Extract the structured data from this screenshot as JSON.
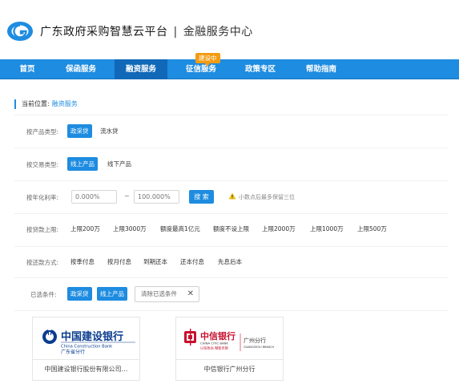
{
  "header": {
    "site_title": "广东政府采购智慧云平台",
    "separator": "|",
    "subtitle": "金融服务中心"
  },
  "nav": {
    "items": [
      {
        "label": "首页",
        "active": false
      },
      {
        "label": "保函服务",
        "active": false
      },
      {
        "label": "融资服务",
        "active": true
      },
      {
        "label": "征信服务",
        "active": false
      },
      {
        "label": "政策专区",
        "active": false
      },
      {
        "label": "帮助指南",
        "active": false
      }
    ],
    "badge": "建设中"
  },
  "breadcrumb": {
    "label": "当前位置:",
    "current": "融资服务"
  },
  "filters": {
    "product_type": {
      "label": "按产品类型:",
      "options": [
        "政采贷",
        "流水贷"
      ],
      "selected": "政采贷"
    },
    "trade_type": {
      "label": "按交易类型:",
      "options": [
        "线上产品",
        "线下产品"
      ],
      "selected": "线上产品"
    },
    "annual_rate": {
      "label": "按年化利率:",
      "min_placeholder": "0.000%",
      "tilde": "~",
      "max_placeholder": "100.000%",
      "search_label": "搜 索",
      "hint": "小数点后最多保留三位"
    },
    "loan_limit": {
      "label": "按贷款上限:",
      "options": [
        "上限200万",
        "上限3000万",
        "额度最高1亿元",
        "额度不设上限",
        "上限2000万",
        "上限1000万",
        "上限500万"
      ]
    },
    "repayment": {
      "label": "按还款方式:",
      "options": [
        "按季付息",
        "按月付息",
        "到期还本",
        "还本付息",
        "先息后本"
      ]
    },
    "selected": {
      "label": "已选条件:",
      "tags": [
        "政采贷",
        "线上产品"
      ],
      "clear_label": "清除已选条件"
    }
  },
  "banks": [
    {
      "name": "中国建设银行股份有限公司…",
      "logo_cn": "中国建设银行",
      "logo_en": "China Construction Bank",
      "logo_branch": "广东省分行"
    },
    {
      "name": "中信银行广州分行",
      "logo_cn": "中信银行",
      "logo_en": "CHINA CITIC BANK",
      "logo_branch": "广州分行",
      "logo_slogan": "以信致远 融智无限",
      "logo_city": "GUANGZHOU BRANCH"
    }
  ],
  "colors": {
    "primary": "#1e8ce0",
    "nav_active": "#1168b8",
    "badge": "#f39c12",
    "warn": "#f0c419",
    "ccb_blue": "#0a3d8f",
    "citic_red": "#c8102e"
  }
}
